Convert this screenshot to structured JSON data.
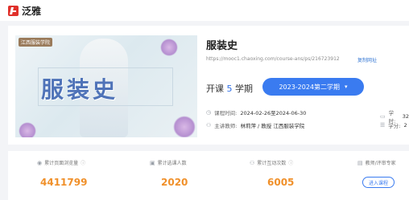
{
  "header": {
    "brand": "泛雅"
  },
  "course": {
    "cover_title": "服装史",
    "cover_tag": "江西服装学院",
    "title": "服装史",
    "url": "https://mooc1.chaoxing.com/course-ans/ps/216723912",
    "copy_label": "复制网址",
    "term_prefix": "开课",
    "term_number": "5",
    "term_suffix": "学期",
    "term_selected": "2023-2024第二学期",
    "time_label": "课程时间:",
    "time_value": "2024-02-26至2024-06-30",
    "teacher_label": "主讲教师:",
    "teacher_value": "林莉萍 / 教授  江西服装学院",
    "hours_label": "学时:",
    "hours_value": "32",
    "credits_label": "学分:",
    "credits_value": "2"
  },
  "stats": [
    {
      "label": "累计页面浏览量",
      "value": "4411799"
    },
    {
      "label": "累计选课人数",
      "value": "2020"
    },
    {
      "label": "累计互动次数",
      "value": "6005"
    },
    {
      "label": "教师/评审专家",
      "button": "进入课程"
    }
  ],
  "colors": {
    "accent": "#3a7bf0",
    "stat": "#f0902a",
    "brand": "#e0312b"
  }
}
